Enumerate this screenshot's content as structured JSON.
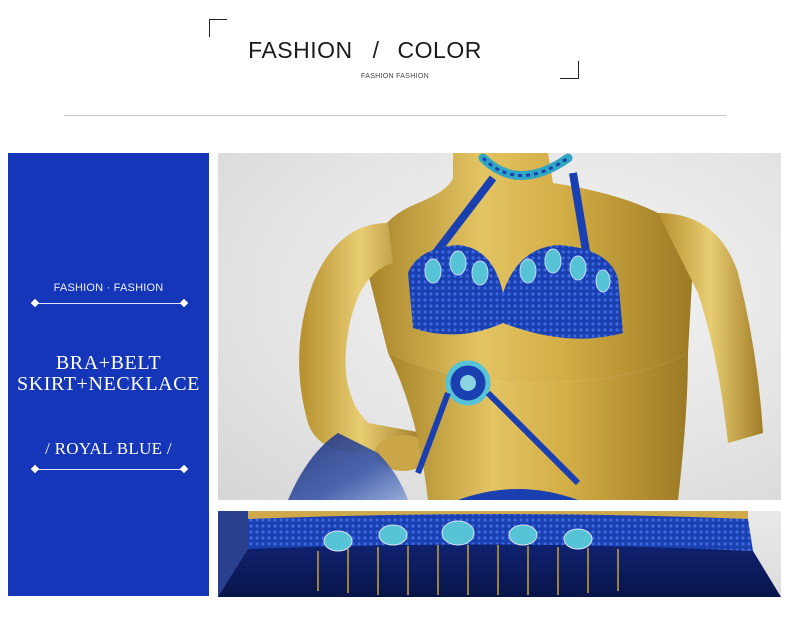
{
  "header": {
    "title_left": "FASHION",
    "title_sep": "/",
    "title_right": "COLOR",
    "subtitle": "FASHION FASHION"
  },
  "panel": {
    "small_label": "FASHION · FASHION",
    "product_line_1": "BRA+BELT",
    "product_line_2": "SKIRT+NECKLACE",
    "color_label": "/ ROYAL BLUE /",
    "background_color": "#1536b8"
  },
  "photos": {
    "top": "mannequin-bra-photo",
    "bottom": "belt-skirt-photo"
  },
  "colors": {
    "royal_blue": "#1536b8",
    "mannequin_gold": "#c9a23a",
    "sequin_blue": "#1a3fb0",
    "crystal_teal": "#3fb6c8"
  }
}
